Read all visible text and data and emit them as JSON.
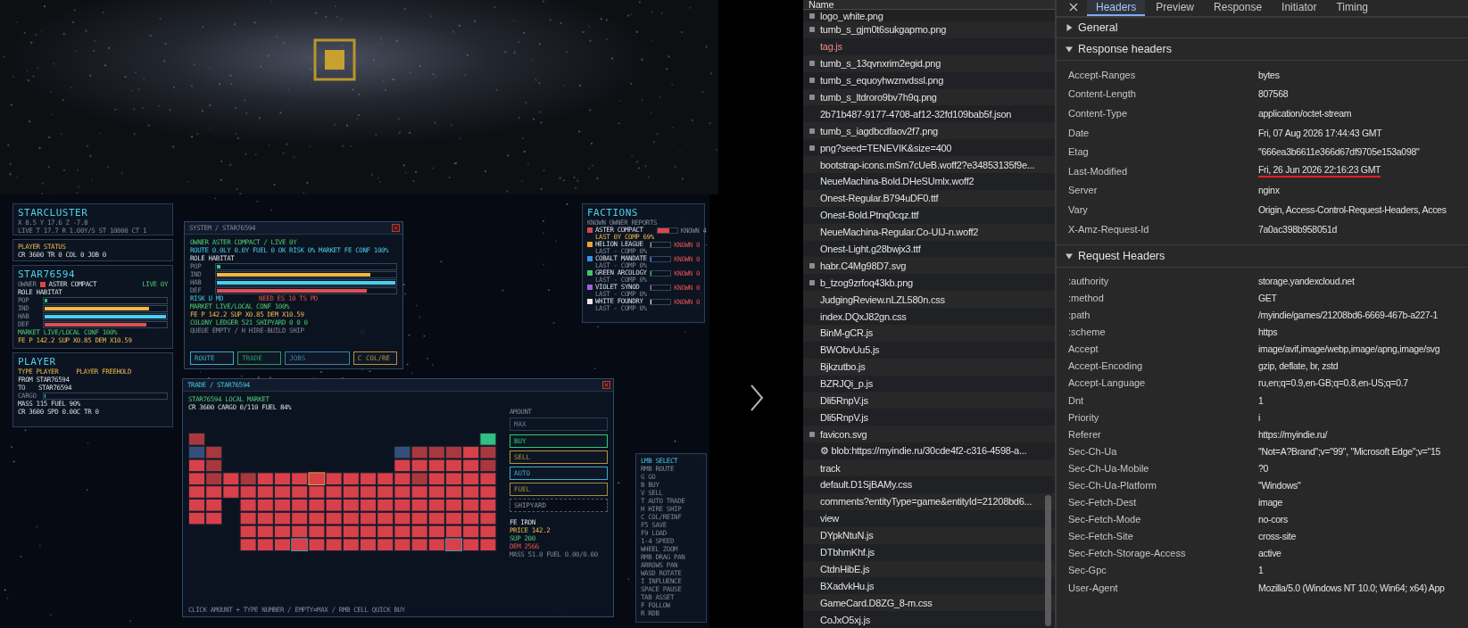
{
  "game": {
    "starcluster": {
      "title": "STARCLUSTER",
      "coords": "X 8.5  Y 17.6  Z -7.8",
      "status": "LIVE  T 17.7  R 1.00Y/S  ST 10000  CT 1"
    },
    "player_status": {
      "title": "PLAYER STATUS",
      "line": "CR 3600 TR 0 COL 0 JOB 0"
    },
    "star_panel": {
      "title": "STAR76594",
      "owner_label": "OWNER",
      "owner": {
        "name": "ASTER COMPACT",
        "color": "#e0444a"
      },
      "age": "LIVE 0Y",
      "role": "ROLE HABITAT",
      "stats": [
        {
          "label": "POP",
          "level": 0.02,
          "color": "#2ecc71"
        },
        {
          "label": "IND",
          "level": 0.86,
          "color": "#f0b840"
        },
        {
          "label": "HAB",
          "level": 1,
          "color": "#45d0ee"
        },
        {
          "label": "DEF",
          "level": 0.84,
          "color": "#e05050"
        }
      ],
      "market": "MARKET LIVE/LOCAL CONF 100%",
      "prices": "FE P 142.2 SUP X0.85 DEM X10.59"
    },
    "player_panel": {
      "title": "PLAYER",
      "type": "TYPE PLAYER",
      "faction": "PLAYER FREEHOLD",
      "from": {
        "label": "FROM",
        "value": "STAR76594"
      },
      "to": {
        "label": "TO",
        "value": "STAR76594"
      },
      "cargo": {
        "label": "CARGO",
        "level": 0
      },
      "mass": "MASS 115 FUEL 90%",
      "speed": "CR 3600 SPD 0.00C TR 0"
    },
    "system_window": {
      "title": "SYSTEM / STAR76594",
      "owner_line": "OWNER ASTER COMPACT / LIVE 0Y",
      "route_line": "ROUTE 0.0LY 0.0Y FUEL 0 OK RISK 0% MARKET FE CONF 100%",
      "role": "ROLE HABITAT",
      "stats": [
        {
          "label": "POP",
          "level": 0.02,
          "color": "#2ecc71"
        },
        {
          "label": "IND",
          "level": 0.86,
          "color": "#f0b840"
        },
        {
          "label": "HAB",
          "level": 1,
          "color": "#45d0ee"
        },
        {
          "label": "DEF",
          "level": 0.84,
          "color": "#e05050"
        }
      ],
      "risk": "RISK U MD",
      "need": "NEED ES 10 TS PD",
      "market": "MARKET LIVE/LOCAL CONF 100%",
      "prices": "FE P 142.2 SUP X0.85 DEM X10.59",
      "ledger": "COLONY LEDGER 521 SHIPYARD 0 0 0",
      "queue": "QUEUE EMPTY / H HIRE-BUILD SHIP",
      "buttons": [
        {
          "label": "ROUTE",
          "color": "#3fa8cc"
        },
        {
          "label": "TRADE",
          "color": "#2e9a5a"
        },
        {
          "label": "JOBS",
          "color": "#3a7fb0"
        },
        {
          "label": "C COL/RE",
          "color": "#b8913a"
        }
      ]
    },
    "trade_window": {
      "title": "TRADE / STAR76594",
      "market_title": "STAR76594 LOCAL MARKET",
      "cargo_line": "CR 3600 CARGO 0/110 FUEL 84%",
      "amount": {
        "label": "AMOUNT",
        "placeholder": "MAX"
      },
      "actions": [
        {
          "label": "BUY",
          "color": "#2ecc71",
          "disabled": false
        },
        {
          "label": "SELL",
          "color": "#b8913a",
          "disabled": false
        },
        {
          "label": "AUTO",
          "color": "#3fa8cc",
          "disabled": false
        },
        {
          "label": "FUEL",
          "color": "#a88a3a",
          "disabled": false
        },
        {
          "label": "SHIPYARD",
          "color": "#4a5a6e",
          "disabled": true
        }
      ],
      "item": {
        "name": "FE IRON",
        "price": "PRICE 142.2",
        "supply": "SUP 200",
        "demand": "DEM 2566",
        "mass": "MASS 51.0 FUEL 0.00/0.00"
      },
      "hint": "CLICK AMOUNT + TYPE NUMBER / EMPTY=MAX / RMB CELL QUICK BUY"
    },
    "factions": {
      "title": "FACTIONS",
      "subtitle": "KNOWN OWNER REPORTS",
      "items": [
        {
          "name": "ASTER COMPACT",
          "color": "#e0444a",
          "last": "LAST 0Y COMP 69%",
          "level": 0.6,
          "known": "KNOWN 4"
        },
        {
          "name": "HELION LEAGUE",
          "color": "#f0a030",
          "last": "LAST - COMP 0%",
          "level": 0,
          "known": "KNOWN 0"
        },
        {
          "name": "COBALT MANDATE",
          "color": "#3a8ee8",
          "last": "LAST - COMP 0%",
          "level": 0,
          "known": "KNOWN 0"
        },
        {
          "name": "GREEN ARCOLOGY",
          "color": "#3cc86a",
          "last": "LAST - COMP 0%",
          "level": 0,
          "known": "KNOWN 0"
        },
        {
          "name": "VIOLET SYNOD",
          "color": "#a060e0",
          "last": "LAST - COMP 0%",
          "level": 0,
          "known": "KNOWN 0"
        },
        {
          "name": "WHITE FOUNDRY",
          "color": "#e8e8e0",
          "last": "LAST - COMP 0%",
          "level": 0,
          "known": "KNOWN 0"
        }
      ]
    },
    "keys": {
      "title": "LMB SELECT",
      "items": [
        "RMB ROUTE",
        "G GO",
        "B BUY",
        "V SELL",
        "T AUTO TRADE",
        "H HIRE SHIP",
        "C COL/REINF",
        "F5 SAVE",
        "F9 LOAD",
        "1-4 SPEED",
        "WHEEL ZOOM",
        "RMB DRAG PAN",
        "ARROWS PAN",
        "WASD ROTATE",
        "I INFLUENCE",
        "SPACE PAUSE",
        "TAB ASSET",
        "F FOLLOW",
        "R RDB"
      ]
    }
  },
  "network": {
    "column": "Name",
    "rows": [
      {
        "name": "logo_white.png",
        "thumbnail": true,
        "failed": false
      },
      {
        "name": "tumb_s_gjm0t6sukgapmo.png",
        "thumbnail": true,
        "failed": false
      },
      {
        "name": "tag.js",
        "thumbnail": false,
        "failed": true
      },
      {
        "name": "tumb_s_13qvnxrim2egid.png",
        "thumbnail": true,
        "failed": false
      },
      {
        "name": "tumb_s_equoyhwznvdssl.png",
        "thumbnail": true,
        "failed": false
      },
      {
        "name": "tumb_s_ltdroro9bv7h9q.png",
        "thumbnail": true,
        "failed": false
      },
      {
        "name": "2b71b487-9177-4708-af12-32fd109bab5f.json",
        "thumbnail": false,
        "failed": false
      },
      {
        "name": "tumb_s_iagdbcdfaov2f7.png",
        "thumbnail": true,
        "failed": false
      },
      {
        "name": "png?seed=TENEVIK&size=400",
        "thumbnail": true,
        "failed": false
      },
      {
        "name": "bootstrap-icons.mSm7cUeB.woff2?e34853135f9e...",
        "thumbnail": false,
        "failed": false
      },
      {
        "name": "NeueMachina-Bold.DHeSUmlx.woff2",
        "thumbnail": false,
        "failed": false
      },
      {
        "name": "Onest-Regular.B794uDF0.ttf",
        "thumbnail": false,
        "failed": false
      },
      {
        "name": "Onest-Bold.Ptnq0cqz.ttf",
        "thumbnail": false,
        "failed": false
      },
      {
        "name": "NeueMachina-Regular.Co-UIJ-n.woff2",
        "thumbnail": false,
        "failed": false
      },
      {
        "name": "Onest-Light.g28bwjx3.ttf",
        "thumbnail": false,
        "failed": false
      },
      {
        "name": "habr.C4Mg98D7.svg",
        "thumbnail": true,
        "failed": false
      },
      {
        "name": "b_tzog9zrfoq43kb.png",
        "thumbnail": true,
        "failed": false
      },
      {
        "name": "JudgingReview.nLZL580n.css",
        "thumbnail": false,
        "failed": false
      },
      {
        "name": "index.DQxJ82gn.css",
        "thumbnail": false,
        "failed": false
      },
      {
        "name": "BinM-gCR.js",
        "thumbnail": false,
        "failed": false
      },
      {
        "name": "BWObvUu5.js",
        "thumbnail": false,
        "failed": false
      },
      {
        "name": "Bjkzutbo.js",
        "thumbnail": false,
        "failed": false
      },
      {
        "name": "BZRJQi_p.js",
        "thumbnail": false,
        "failed": false
      },
      {
        "name": "Dli5RnpV.js",
        "thumbnail": false,
        "failed": false
      },
      {
        "name": "Dli5RnpV.js",
        "thumbnail": false,
        "failed": false
      },
      {
        "name": "favicon.svg",
        "thumbnail": true,
        "failed": false
      },
      {
        "name": "⚙ blob:https://myindie.ru/30cde4f2-c316-4598-a...",
        "thumbnail": false,
        "failed": false
      },
      {
        "name": "track",
        "thumbnail": false,
        "failed": false
      },
      {
        "name": "default.D1SjBAMy.css",
        "thumbnail": false,
        "failed": false
      },
      {
        "name": "comments?entityType=game&entityId=21208bd6...",
        "thumbnail": false,
        "failed": false
      },
      {
        "name": "view",
        "thumbnail": false,
        "failed": false
      },
      {
        "name": "DYpkNtuN.js",
        "thumbnail": false,
        "failed": false
      },
      {
        "name": "DTbhmKhf.js",
        "thumbnail": false,
        "failed": false
      },
      {
        "name": "CtdnHibE.js",
        "thumbnail": false,
        "failed": false
      },
      {
        "name": "BXadvkHu.js",
        "thumbnail": false,
        "failed": false
      },
      {
        "name": "GameCard.D8ZG_8-m.css",
        "thumbnail": false,
        "failed": false
      },
      {
        "name": "CoJxO5xj.js",
        "thumbnail": false,
        "failed": false
      }
    ]
  },
  "headers": {
    "tabs": [
      {
        "label": "Headers",
        "selected": true
      },
      {
        "label": "Preview",
        "selected": false
      },
      {
        "label": "Response",
        "selected": false
      },
      {
        "label": "Initiator",
        "selected": false
      },
      {
        "label": "Timing",
        "selected": false
      }
    ],
    "sections": [
      {
        "title": "General",
        "expanded": false
      },
      {
        "title": "Response headers",
        "expanded": true,
        "rows": [
          {
            "name": "Accept-Ranges",
            "value": "bytes",
            "underlined": false
          },
          {
            "name": "Content-Length",
            "value": "807568",
            "underlined": false
          },
          {
            "name": "Content-Type",
            "value": "application/octet-stream",
            "underlined": false
          },
          {
            "name": "Date",
            "value": "Fri, 07 Aug 2026 17:44:43 GMT",
            "underlined": false
          },
          {
            "name": "Etag",
            "value": "\"666ea3b6611e366d67df9705e153a098\"",
            "underlined": false
          },
          {
            "name": "Last-Modified",
            "value": "Fri, 26 Jun 2026 22:16:23 GMT",
            "underlined": true
          },
          {
            "name": "Server",
            "value": "nginx",
            "underlined": false
          },
          {
            "name": "Vary",
            "value": "Origin, Access-Control-Request-Headers, Acces",
            "underlined": false
          },
          {
            "name": "X-Amz-Request-Id",
            "value": "7a0ac398b958051d",
            "underlined": false
          }
        ]
      },
      {
        "title": "Request Headers",
        "expanded": true,
        "rows": [
          {
            "name": ":authority",
            "value": "storage.yandexcloud.net",
            "underlined": false
          },
          {
            "name": ":method",
            "value": "GET",
            "underlined": false
          },
          {
            "name": ":path",
            "value": "/myindie/games/21208bd6-6669-467b-a227-1",
            "underlined": false
          },
          {
            "name": ":scheme",
            "value": "https",
            "underlined": false
          },
          {
            "name": "Accept",
            "value": "image/avif,image/webp,image/apng,image/svg",
            "underlined": false
          },
          {
            "name": "Accept-Encoding",
            "value": "gzip, deflate, br, zstd",
            "underlined": false
          },
          {
            "name": "Accept-Language",
            "value": "ru,en;q=0.9,en-GB;q=0.8,en-US;q=0.7",
            "underlined": false
          },
          {
            "name": "Dnt",
            "value": "1",
            "underlined": false
          },
          {
            "name": "Priority",
            "value": "i",
            "underlined": false
          },
          {
            "name": "Referer",
            "value": "https://myindie.ru/",
            "underlined": false
          },
          {
            "name": "Sec-Ch-Ua",
            "value": "\"Not=A?Brand\";v=\"99\", \"Microsoft Edge\";v=\"15",
            "underlined": false
          },
          {
            "name": "Sec-Ch-Ua-Mobile",
            "value": "?0",
            "underlined": false
          },
          {
            "name": "Sec-Ch-Ua-Platform",
            "value": "\"Windows\"",
            "underlined": false
          },
          {
            "name": "Sec-Fetch-Dest",
            "value": "image",
            "underlined": false
          },
          {
            "name": "Sec-Fetch-Mode",
            "value": "no-cors",
            "underlined": false
          },
          {
            "name": "Sec-Fetch-Site",
            "value": "cross-site",
            "underlined": false
          },
          {
            "name": "Sec-Fetch-Storage-Access",
            "value": "active",
            "underlined": false
          },
          {
            "name": "Sec-Gpc",
            "value": "1",
            "underlined": false
          },
          {
            "name": "User-Agent",
            "value": "Mozilla/5.0 (Windows NT 10.0; Win64; x64) App",
            "underlined": false
          }
        ]
      }
    ]
  }
}
